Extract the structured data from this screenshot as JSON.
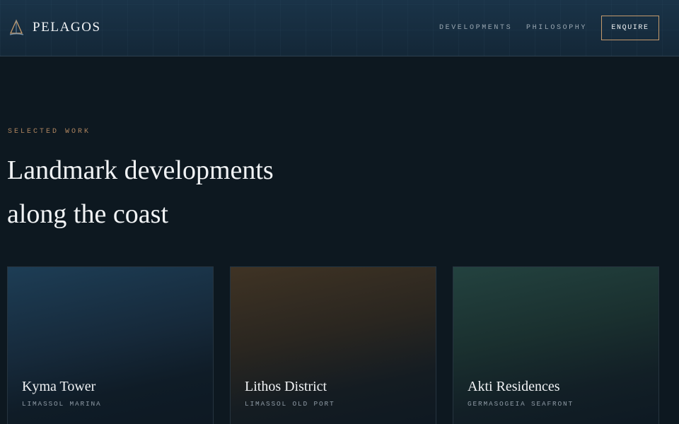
{
  "header": {
    "brand": "PELAGOS",
    "logo_icon": "sail-triangle-icon",
    "nav": {
      "developments": "DEVELOPMENTS",
      "philosophy": "PHILOSOPHY"
    },
    "cta_label": "ENQUIRE"
  },
  "hero": {
    "eyebrow": "SELECTED WORK",
    "headline_line1": "Landmark developments",
    "headline_line2": "along the coast"
  },
  "projects": [
    {
      "name": "Kyma Tower",
      "location": "LIMASSOL MARINA"
    },
    {
      "name": "Lithos District",
      "location": "LIMASSOL OLD PORT"
    },
    {
      "name": "Akti Residences",
      "location": "GERMASOGEIA SEAFRONT"
    }
  ],
  "colors": {
    "background": "#0d1820",
    "accent_gold": "#c49a6c",
    "eyebrow": "#b08660",
    "text_primary": "#f1f3f5",
    "text_muted": "#9aa7b2"
  }
}
